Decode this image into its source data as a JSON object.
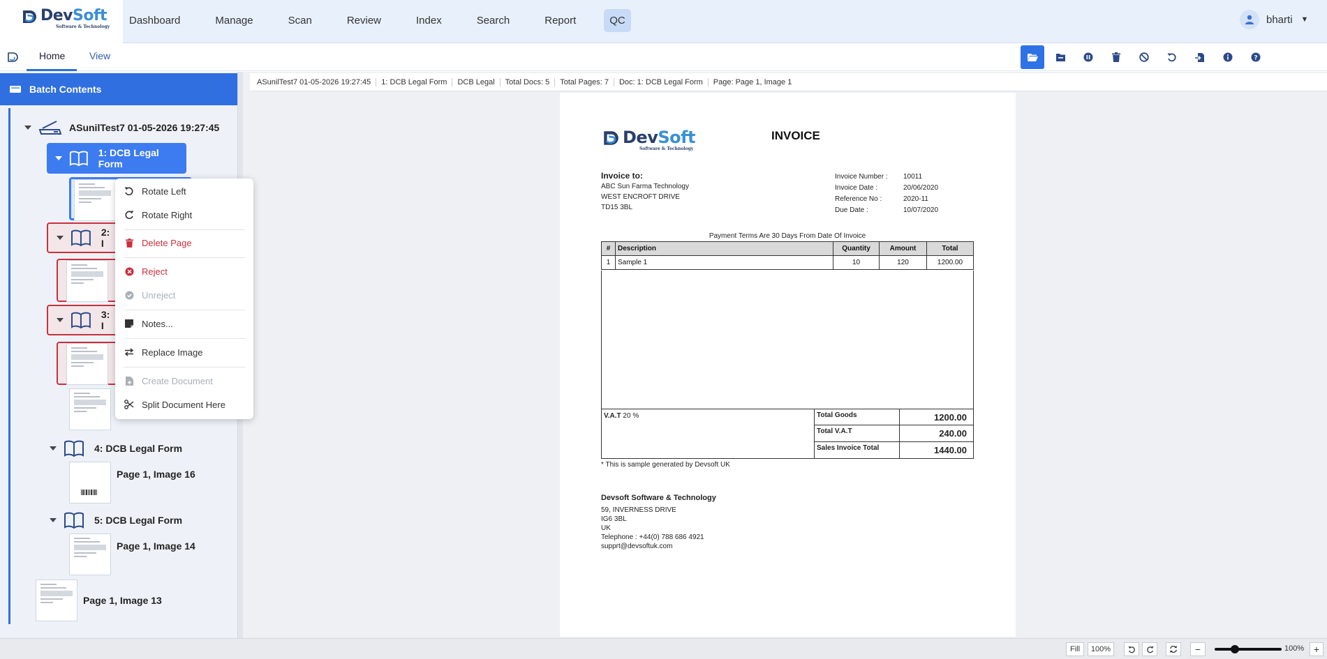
{
  "brand": {
    "name_part1": "Dev",
    "name_part2": "Soft",
    "tagline": "Software & Technology"
  },
  "nav": {
    "items": [
      {
        "label": "Dashboard"
      },
      {
        "label": "Manage"
      },
      {
        "label": "Scan"
      },
      {
        "label": "Review"
      },
      {
        "label": "Index"
      },
      {
        "label": "Search"
      },
      {
        "label": "Report"
      },
      {
        "label": "QC"
      }
    ],
    "active": "QC"
  },
  "user": {
    "name": "bharti"
  },
  "tabs": {
    "home": "Home",
    "view": "View",
    "active": "Home"
  },
  "toolbar": {
    "icons": [
      "folder-open-icon",
      "folder-icon",
      "pause-icon",
      "trash-icon",
      "block-icon",
      "undo-icon",
      "import-icon",
      "info-icon",
      "help-icon"
    ]
  },
  "batch": {
    "header": "Batch Contents",
    "root": "ASunilTest7 01-05-2026 19:27:45",
    "docs": [
      {
        "label": "1: DCB Legal Form",
        "state": "selected"
      },
      {
        "label": "2: DCB Legal Form",
        "visible": "2: I",
        "state": "rejected"
      },
      {
        "label": "3: DCB Legal Form",
        "visible": "3: I",
        "state": "rejected"
      },
      {
        "label": "4: DCB Legal Form",
        "page": "Page 1, Image 16"
      },
      {
        "label": "5: DCB Legal Form",
        "page": "Page 1, Image 14"
      }
    ],
    "loose_page": "Page 1, Image 13"
  },
  "context_menu": {
    "rotate_left": "Rotate Left",
    "rotate_right": "Rotate Right",
    "delete_page": "Delete Page",
    "reject": "Reject",
    "unreject": "Unreject",
    "notes": "Notes...",
    "replace_image": "Replace Image",
    "create_document": "Create Document",
    "split_document": "Split Document Here"
  },
  "breadcrumb": [
    "ASunilTest7 01-05-2026 19:27:45",
    "1: DCB Legal Form",
    "DCB Legal",
    "Total Docs: 5",
    "Total Pages: 7",
    "Doc: 1: DCB Legal Form",
    "Page: Page 1, Image 1"
  ],
  "invoice": {
    "title": "INVOICE",
    "bill_to_heading": "Invoice to:",
    "bill_to": [
      "ABC Sun Farma Technology",
      "WEST ENCROFT DRIVE",
      "TD15 3BL"
    ],
    "meta": [
      {
        "k": "Invoice Number :",
        "v": "10011"
      },
      {
        "k": "Invoice Date :",
        "v": "20/06/2020"
      },
      {
        "k": "Reference No :",
        "v": "2020-11"
      },
      {
        "k": "Due Date :",
        "v": "10/07/2020"
      }
    ],
    "payment_terms": "Payment Terms Are 30 Days From Date Of Invoice",
    "columns": {
      "num": "#",
      "desc": "Description",
      "qty": "Quantity",
      "amount": "Amount",
      "total": "Total"
    },
    "rows": [
      {
        "num": "1",
        "desc": "Sample 1",
        "qty": "10",
        "amount": "120",
        "total": "1200.00"
      }
    ],
    "vat_label": "V.A.T",
    "vat_rate": "20 %",
    "totals": [
      {
        "k": "Total Goods",
        "v": "1200.00"
      },
      {
        "k": "Total V.A.T",
        "v": "240.00"
      },
      {
        "k": "Sales Invoice Total",
        "v": "1440.00"
      }
    ],
    "footnote": "* This is sample generated by Devsoft UK",
    "company": {
      "name": "Devsoft Software & Technology",
      "lines": [
        "59, INVERNESS DRIVE",
        "IG6 3BL",
        "UK",
        "Telephone : +44(0) 788 686 4921",
        "supprt@devsoftuk.com"
      ]
    }
  },
  "statusbar": {
    "fill": "Fill",
    "zoom_preset": "100%",
    "zoom_level": "100%",
    "zoom_fraction": 0.3,
    "minus": "−",
    "plus": "+"
  }
}
